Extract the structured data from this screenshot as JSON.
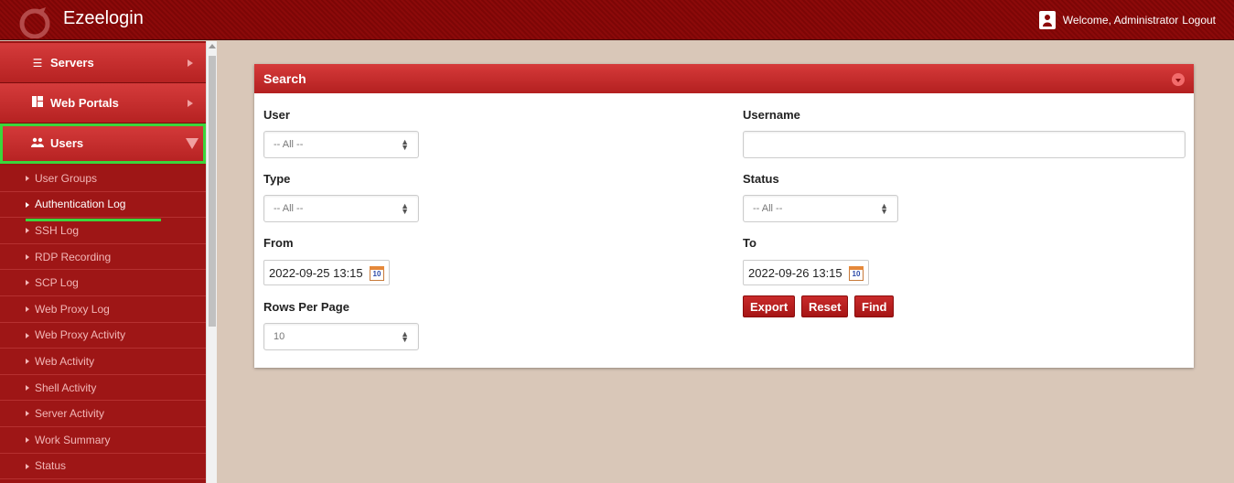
{
  "app": {
    "title": "Ezeelogin",
    "welcome_text": "Welcome, Administrator",
    "logout_label": "Logout"
  },
  "sidebar": {
    "main_items": [
      {
        "label": "Servers",
        "icon": "list-icon"
      },
      {
        "label": "Web Portals",
        "icon": "dashboard-icon"
      },
      {
        "label": "Users",
        "icon": "users-icon",
        "active": true
      }
    ],
    "sub_items": [
      {
        "label": "User Groups"
      },
      {
        "label": "Authentication Log",
        "selected": true
      },
      {
        "label": "SSH Log"
      },
      {
        "label": "RDP Recording"
      },
      {
        "label": "SCP Log"
      },
      {
        "label": "Web Proxy Log"
      },
      {
        "label": "Web Proxy Activity"
      },
      {
        "label": "Web Activity"
      },
      {
        "label": "Shell Activity"
      },
      {
        "label": "Server Activity"
      },
      {
        "label": "Work Summary"
      },
      {
        "label": "Status"
      }
    ]
  },
  "search": {
    "title": "Search",
    "user_label": "User",
    "user_value": "-- All --",
    "username_label": "Username",
    "username_value": "",
    "type_label": "Type",
    "type_value": "-- All --",
    "status_label": "Status",
    "status_value": "-- All --",
    "from_label": "From",
    "from_value": "2022-09-25 13:15",
    "to_label": "To",
    "to_value": "2022-09-26 13:15",
    "rows_label": "Rows Per Page",
    "rows_value": "10",
    "calendar_day": "10",
    "export_label": "Export",
    "reset_label": "Reset",
    "find_label": "Find"
  },
  "colors": {
    "header_bg": "#8c0a0a",
    "sidebar_bg": "#9b1414",
    "accent_red": "#c92a2a",
    "highlight_green": "#3bd63b",
    "page_bg": "#d9c7b8"
  }
}
